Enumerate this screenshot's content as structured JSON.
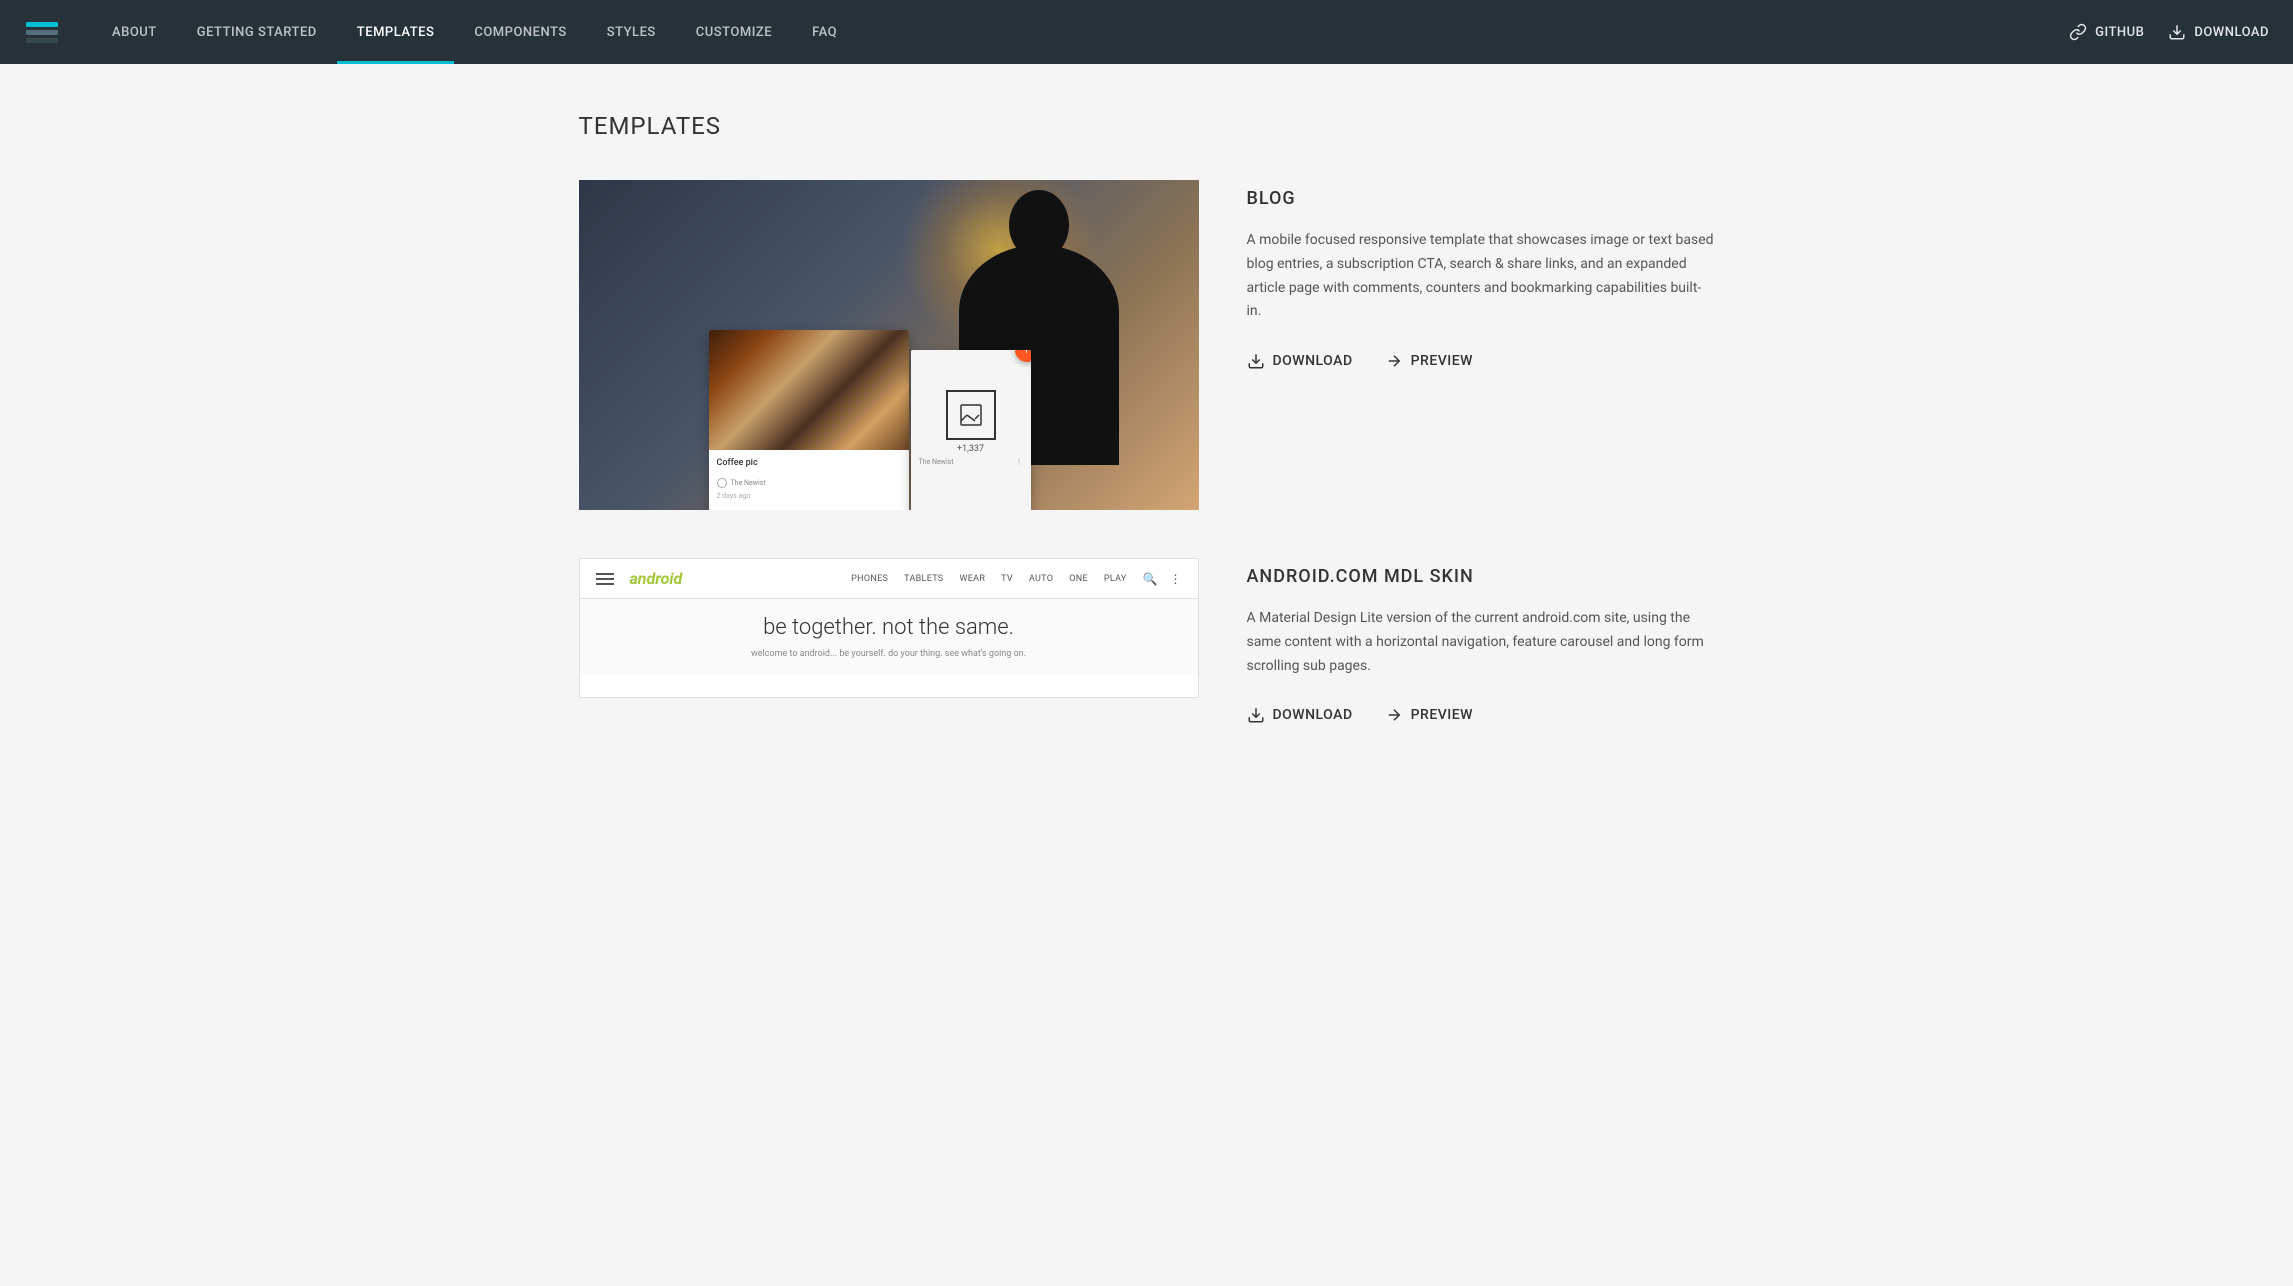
{
  "header": {
    "logo_alt": "MDL Logo",
    "nav": [
      {
        "label": "ABOUT",
        "href": "#",
        "active": false,
        "id": "about"
      },
      {
        "label": "GETTING STARTED",
        "href": "#",
        "active": false,
        "id": "getting-started"
      },
      {
        "label": "TEMPLATES",
        "href": "#",
        "active": true,
        "id": "templates"
      },
      {
        "label": "COMPONENTS",
        "href": "#",
        "active": false,
        "id": "components"
      },
      {
        "label": "STYLES",
        "href": "#",
        "active": false,
        "id": "styles"
      },
      {
        "label": "CUSTOMIZE",
        "href": "#",
        "active": false,
        "id": "customize"
      },
      {
        "label": "FAQ",
        "href": "#",
        "active": false,
        "id": "faq"
      }
    ],
    "github_label": "GitHub",
    "download_label": "Download"
  },
  "main": {
    "page_title": "TEMPLATES",
    "templates": [
      {
        "id": "blog",
        "name": "BLOG",
        "description": "A mobile focused responsive template that showcases image or text based blog entries, a subscription CTA, search & share links, and an expanded article page with comments, counters and bookmarking capabilities built-in.",
        "download_label": "Download",
        "preview_label": "Preview",
        "preview_image_alt": "Blog template preview"
      },
      {
        "id": "android-mdl",
        "name": "ANDROID.COM MDL SKIN",
        "description": "A Material Design Lite version of the current android.com site, using the same content with a horizontal navigation, feature carousel and long form scrolling sub pages.",
        "download_label": "Download",
        "preview_label": "Preview",
        "preview_image_alt": "Android.com MDL Skin preview"
      }
    ]
  },
  "blog_preview": {
    "coffee_pic_label": "Coffee pic",
    "newest_label": "The Newist",
    "days_ago": "2 days ago",
    "share_count": "+1,337"
  },
  "android_preview": {
    "nav_links": [
      "PHONES",
      "TABLETS",
      "WEAR",
      "TV",
      "AUTO",
      "ONE",
      "PLAY"
    ],
    "logo": "android",
    "hero_title": "be together. not the same.",
    "hero_subtitle": "welcome to android... be yourself. do your thing. see what's going on."
  }
}
